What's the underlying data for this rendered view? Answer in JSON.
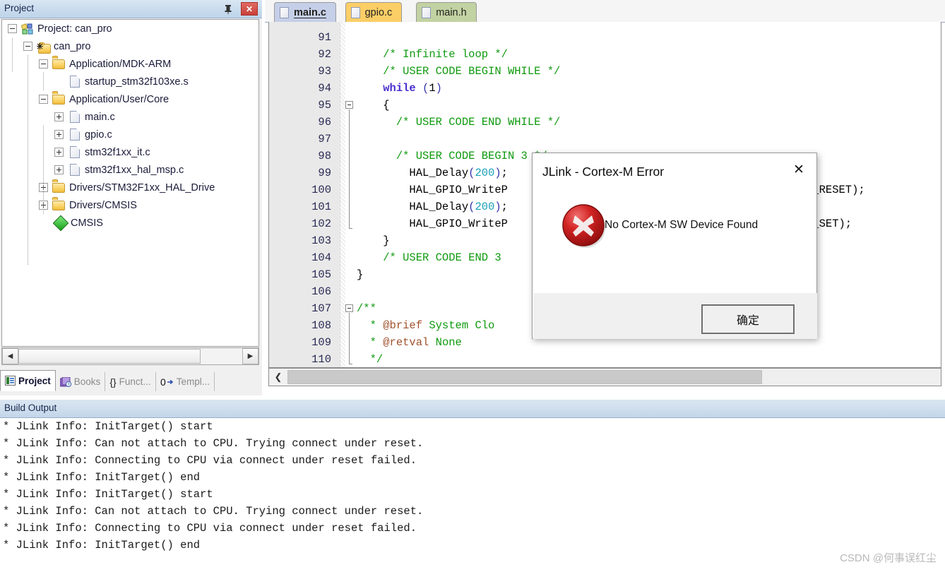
{
  "project_panel": {
    "title": "Project",
    "pin_icon": "pin-icon",
    "close_icon": "close-icon",
    "tree": [
      {
        "label": "Project: can_pro",
        "depth": 0,
        "expander": "minus",
        "icon": "project-icon"
      },
      {
        "label": "can_pro",
        "depth": 1,
        "expander": "minus",
        "icon": "target-group-icon"
      },
      {
        "label": "Application/MDK-ARM",
        "depth": 2,
        "expander": "minus",
        "icon": "folder-icon"
      },
      {
        "label": "startup_stm32f103xe.s",
        "depth": 3,
        "expander": "none",
        "icon": "file-icon"
      },
      {
        "label": "Application/User/Core",
        "depth": 2,
        "expander": "minus",
        "icon": "folder-icon"
      },
      {
        "label": "main.c",
        "depth": 3,
        "expander": "plus",
        "icon": "file-icon"
      },
      {
        "label": "gpio.c",
        "depth": 3,
        "expander": "plus",
        "icon": "file-icon"
      },
      {
        "label": "stm32f1xx_it.c",
        "depth": 3,
        "expander": "plus",
        "icon": "file-icon"
      },
      {
        "label": "stm32f1xx_hal_msp.c",
        "depth": 3,
        "expander": "plus",
        "icon": "file-icon"
      },
      {
        "label": "Drivers/STM32F1xx_HAL_Drive",
        "depth": 2,
        "expander": "plus",
        "icon": "folder-icon"
      },
      {
        "label": "Drivers/CMSIS",
        "depth": 2,
        "expander": "plus",
        "icon": "folder-icon"
      },
      {
        "label": "CMSIS",
        "depth": 2,
        "expander": "none",
        "icon": "cmsis-diamond-icon"
      }
    ],
    "hscroll": {
      "left_arrow": "◀",
      "right_arrow": "▶"
    },
    "bottom_tabs": [
      {
        "label": "Project",
        "icon": "project-tab-icon",
        "active": true
      },
      {
        "label": "Books",
        "icon": "books-icon",
        "active": false
      },
      {
        "label": "Funct...",
        "icon": "functions-icon",
        "active": false
      },
      {
        "label": "Templ...",
        "icon": "templates-icon",
        "active": false
      }
    ]
  },
  "editor": {
    "tabs": [
      {
        "label": "main.c",
        "active": true,
        "color": "#c5cfe8",
        "icon": "file-icon"
      },
      {
        "label": "gpio.c",
        "active": false,
        "color": "#fcce66",
        "icon": "file-icon"
      },
      {
        "label": "main.h",
        "active": false,
        "color": "#c2d2a3",
        "icon": "file-icon"
      }
    ],
    "first_line_number": 91,
    "lines": [
      {
        "n": 91,
        "segments": []
      },
      {
        "n": 92,
        "segments": [
          {
            "t": "    ",
            "c": ""
          },
          {
            "t": "/* Infinite loop */",
            "c": "cmt"
          }
        ]
      },
      {
        "n": 93,
        "segments": [
          {
            "t": "    ",
            "c": ""
          },
          {
            "t": "/* USER CODE BEGIN WHILE */",
            "c": "cmt"
          }
        ]
      },
      {
        "n": 94,
        "segments": [
          {
            "t": "    ",
            "c": ""
          },
          {
            "t": "while",
            "c": "kw"
          },
          {
            "t": " ",
            "c": ""
          },
          {
            "t": "(",
            "c": "pun"
          },
          {
            "t": "1",
            "c": ""
          },
          {
            "t": ")",
            "c": "pun"
          }
        ]
      },
      {
        "n": 95,
        "segments": [
          {
            "t": "    {",
            "c": ""
          }
        ],
        "fold": "start"
      },
      {
        "n": 96,
        "segments": [
          {
            "t": "      ",
            "c": ""
          },
          {
            "t": "/* USER CODE END WHILE */",
            "c": "cmt"
          }
        ]
      },
      {
        "n": 97,
        "segments": []
      },
      {
        "n": 98,
        "segments": [
          {
            "t": "      ",
            "c": ""
          },
          {
            "t": "/* USER CODE BEGIN 3 */",
            "c": "cmt"
          }
        ]
      },
      {
        "n": 99,
        "segments": [
          {
            "t": "        HAL_Delay",
            "c": ""
          },
          {
            "t": "(",
            "c": "pun"
          },
          {
            "t": "200",
            "c": "num"
          },
          {
            "t": ")",
            "c": "pun"
          },
          {
            "t": ";",
            "c": ""
          }
        ]
      },
      {
        "n": 100,
        "segments": [
          {
            "t": "        HAL_GPIO_WriteP",
            "c": ""
          }
        ],
        "tail": "N_RESET);"
      },
      {
        "n": 101,
        "segments": [
          {
            "t": "        HAL_Delay",
            "c": ""
          },
          {
            "t": "(",
            "c": "pun"
          },
          {
            "t": "200",
            "c": "num"
          },
          {
            "t": ")",
            "c": "pun"
          },
          {
            "t": ";",
            "c": ""
          }
        ]
      },
      {
        "n": 102,
        "segments": [
          {
            "t": "        HAL_GPIO_WriteP",
            "c": ""
          }
        ],
        "tail": "N_SET);",
        "fold": "end"
      },
      {
        "n": 103,
        "segments": [
          {
            "t": "    }",
            "c": ""
          }
        ]
      },
      {
        "n": 104,
        "segments": [
          {
            "t": "    ",
            "c": ""
          },
          {
            "t": "/* USER CODE END 3 ",
            "c": "cmt"
          }
        ]
      },
      {
        "n": 105,
        "segments": [
          {
            "t": "}",
            "c": ""
          }
        ]
      },
      {
        "n": 106,
        "segments": []
      },
      {
        "n": 107,
        "segments": [
          {
            "t": "/**",
            "c": "cmt"
          }
        ],
        "fold": "start2"
      },
      {
        "n": 108,
        "segments": [
          {
            "t": "  * ",
            "c": "cmt"
          },
          {
            "t": "@brief",
            "c": "dox"
          },
          {
            "t": " System Clo",
            "c": "cmt"
          }
        ]
      },
      {
        "n": 109,
        "segments": [
          {
            "t": "  * ",
            "c": "cmt"
          },
          {
            "t": "@retval",
            "c": "dox"
          },
          {
            "t": " None",
            "c": "cmt"
          }
        ]
      },
      {
        "n": 110,
        "segments": [
          {
            "t": "  */",
            "c": "cmt"
          }
        ],
        "fold": "end2"
      }
    ],
    "hscroll": {
      "left_arrow": "❮"
    }
  },
  "dialog": {
    "title": "JLink - Cortex-M Error",
    "close_icon": "close-icon",
    "error_icon": "error-circle-x-icon",
    "message": "No Cortex-M SW Device Found",
    "ok_label": "确定"
  },
  "build_output": {
    "header": "Build Output",
    "lines": [
      "* JLink Info: InitTarget() start",
      "* JLink Info: Can not attach to CPU. Trying connect under reset.",
      "* JLink Info: Connecting to CPU via connect under reset failed.",
      "* JLink Info: InitTarget() end",
      "* JLink Info: InitTarget() start",
      "* JLink Info: Can not attach to CPU. Trying connect under reset.",
      "* JLink Info: Connecting to CPU via connect under reset failed.",
      "* JLink Info: InitTarget() end"
    ]
  },
  "watermark": "CSDN @何事误红尘"
}
